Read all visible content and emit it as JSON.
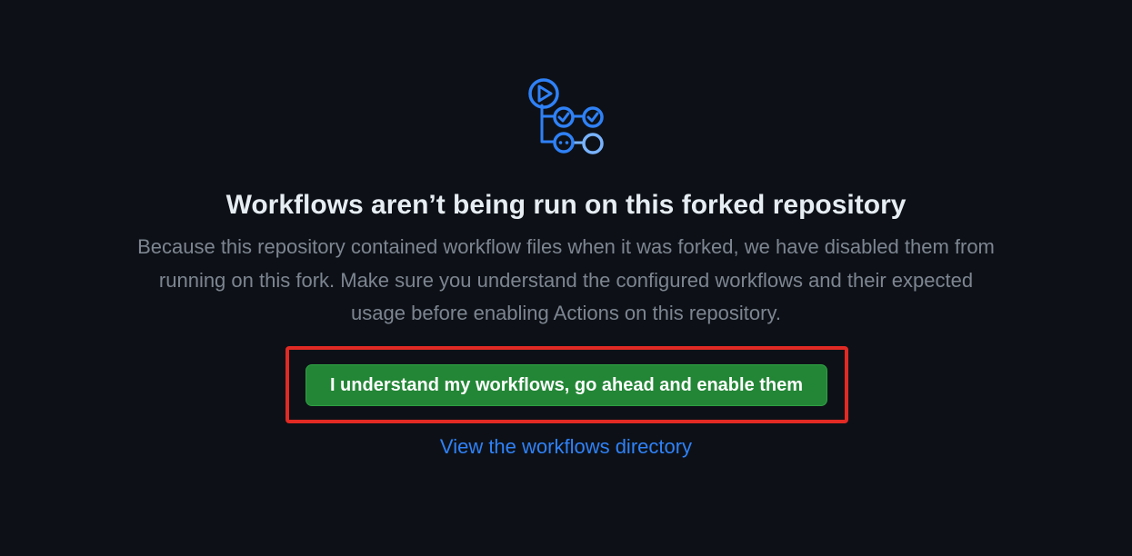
{
  "empty_state": {
    "icon": "actions-workflow-icon",
    "title": "Workflows aren’t being run on this forked repository",
    "description_lines": [
      "Because this repository contained workflow files when it was forked, we have disabled them from",
      "running on this fork. Make sure you understand the configured workflows and their expected",
      "usage before enabling Actions on this repository."
    ],
    "enable_button_label": "I understand my workflows, go ahead and enable them",
    "view_link_label": "View the workflows directory"
  },
  "colors": {
    "background": "#0d1117",
    "title": "#e6edf3",
    "muted_text": "#7d8590",
    "accent_blue": "#2f81f7",
    "button_green": "#238636",
    "highlight_red": "#e12a24"
  }
}
